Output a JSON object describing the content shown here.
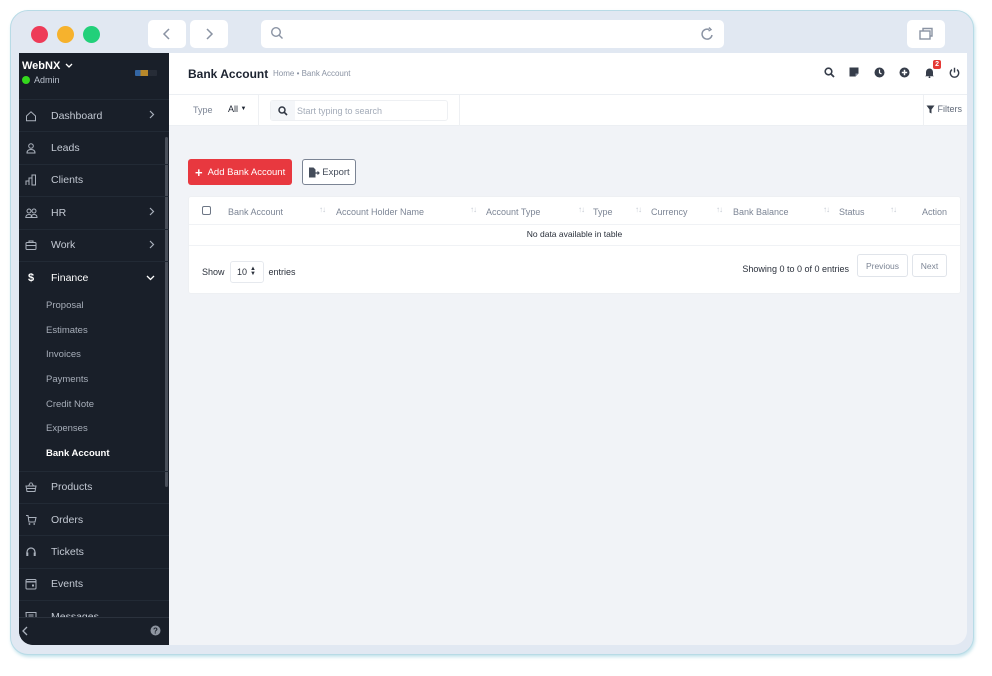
{
  "browser": {
    "back_icon": "chevron-left-icon",
    "forward_icon": "chevron-right-icon",
    "url_search_icon": "search-icon",
    "reload_icon": "reload-icon",
    "tabs_icon": "window-tabs-icon",
    "url_value": ""
  },
  "sidebar": {
    "brand": "WebNX",
    "role": "Admin",
    "status_color": "#34d81d",
    "items": [
      {
        "label": "Dashboard",
        "icon": "home-icon",
        "has_chevron": true
      },
      {
        "label": "Leads",
        "icon": "user-icon",
        "has_chevron": false
      },
      {
        "label": "Clients",
        "icon": "building-icon",
        "has_chevron": false
      },
      {
        "label": "HR",
        "icon": "users-icon",
        "has_chevron": true
      },
      {
        "label": "Work",
        "icon": "briefcase-icon",
        "has_chevron": true
      },
      {
        "label": "Finance",
        "icon": "dollar-icon",
        "has_chevron": true,
        "expanded": true
      }
    ],
    "finance_sub": [
      {
        "label": "Proposal"
      },
      {
        "label": "Estimates"
      },
      {
        "label": "Invoices"
      },
      {
        "label": "Payments"
      },
      {
        "label": "Credit Note"
      },
      {
        "label": "Expenses"
      },
      {
        "label": "Bank Account",
        "active": true
      }
    ],
    "items_after": [
      {
        "label": "Products",
        "icon": "basket-icon"
      },
      {
        "label": "Orders",
        "icon": "cart-icon"
      },
      {
        "label": "Tickets",
        "icon": "headset-icon"
      },
      {
        "label": "Events",
        "icon": "calendar-icon"
      },
      {
        "label": "Messages",
        "icon": "message-icon"
      }
    ],
    "collapse_icon": "chevron-left-icon",
    "help_icon": "help-icon"
  },
  "header": {
    "title": "Bank Account",
    "breadcrumb": "Home • Bank Account",
    "notification_count": "2",
    "icons": [
      "search-icon",
      "sticky-note-icon",
      "clock-icon",
      "plus-circle-icon",
      "bell-icon",
      "power-icon"
    ]
  },
  "filters": {
    "type_label": "Type",
    "type_value": "All",
    "search_placeholder": "Start typing to search",
    "search_value": "",
    "filters_label": "Filters"
  },
  "actions": {
    "add_label": "Add Bank Account",
    "export_label": "Export"
  },
  "table": {
    "columns": [
      "Bank Account",
      "Account Holder Name",
      "Account Type",
      "Type",
      "Currency",
      "Bank Balance",
      "Status",
      "Action"
    ],
    "empty_message": "No data available in table",
    "show_label": "Show",
    "page_length": "10",
    "entries_label": "entries",
    "info": "Showing 0 to 0 of 0 entries",
    "previous_label": "Previous",
    "next_label": "Next"
  },
  "colors": {
    "accent_red": "#e8383f",
    "sidebar_bg": "#191f29",
    "badge_red": "#e53935"
  }
}
